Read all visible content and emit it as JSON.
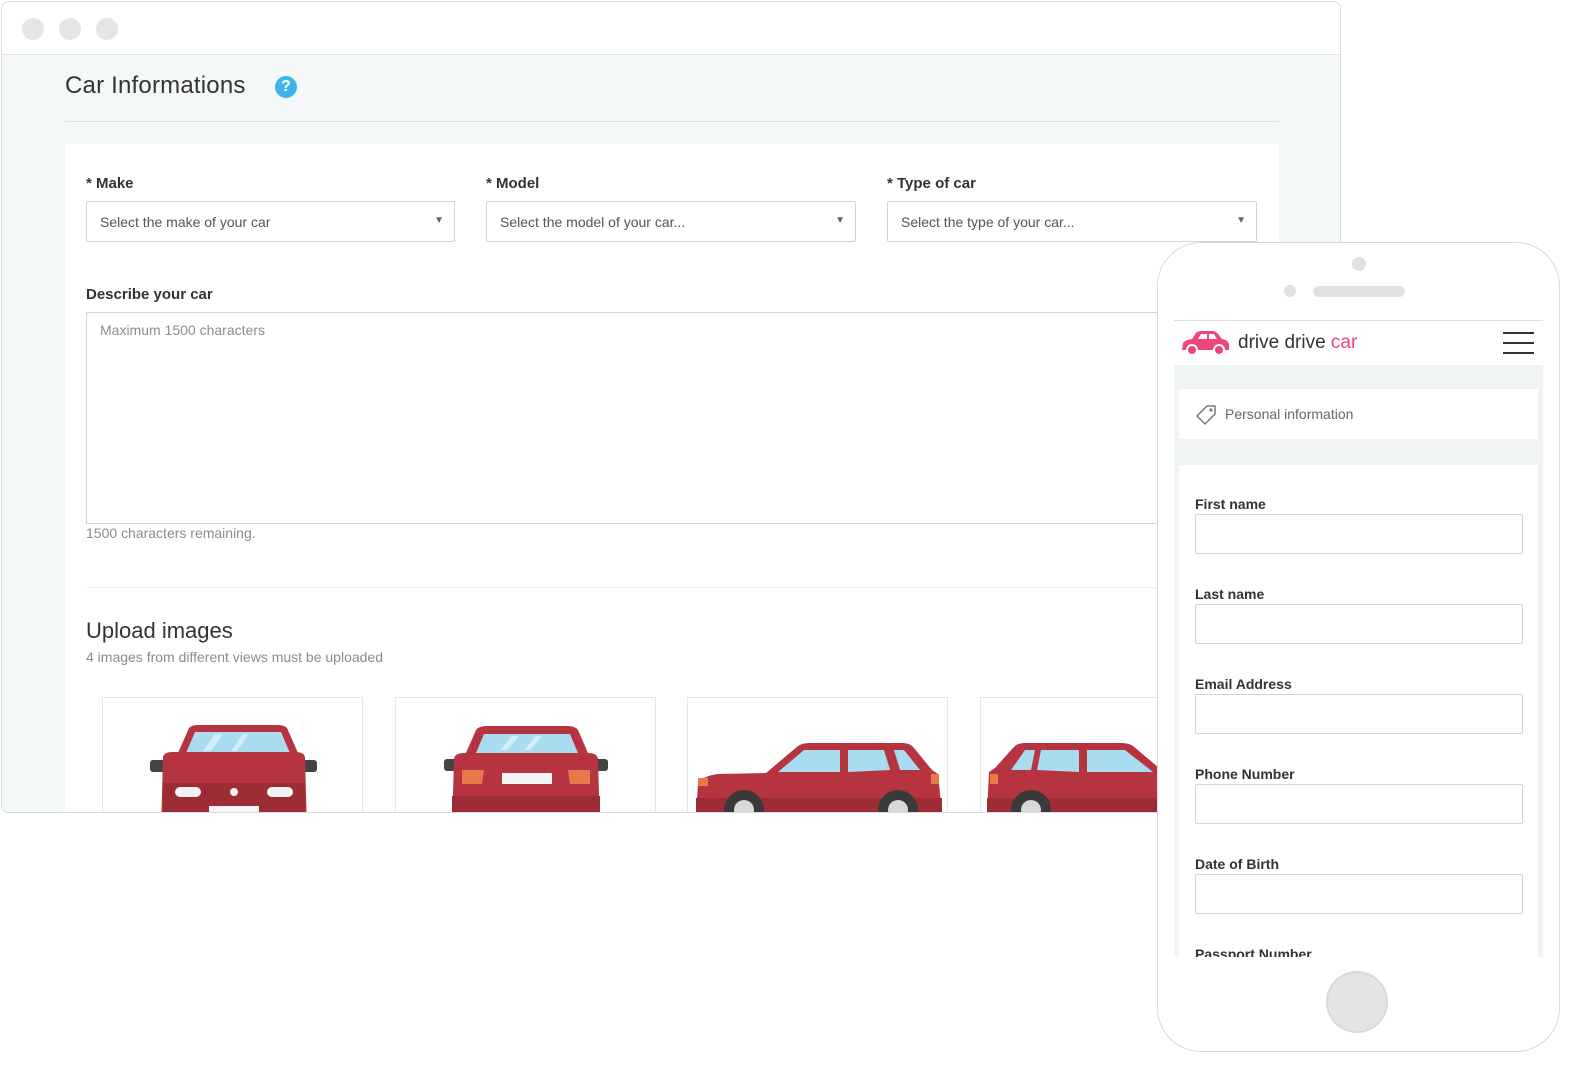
{
  "desktop": {
    "page_title": "Car Informations",
    "help_icon": "help-circle-icon",
    "make": {
      "label": "* Make",
      "placeholder": "Select the make of your car"
    },
    "model": {
      "label": "* Model",
      "placeholder": "Select the model of your car..."
    },
    "type": {
      "label": "* Type of car",
      "placeholder": "Select the type of your car..."
    },
    "description": {
      "label": "Describe your car",
      "placeholder": "Maximum 1500 characters",
      "remaining": "1500 characters remaining."
    },
    "upload": {
      "title": "Upload images",
      "subtitle": "4 images from different views must be uploaded",
      "tiles": [
        "car-front-image",
        "car-rear-image",
        "car-left-side-image",
        "car-right-side-image"
      ]
    },
    "car_color": "#b5343f"
  },
  "mobile": {
    "brand_part1": "drive drive ",
    "brand_part2": "car",
    "brand_accent_color": "#f0457a",
    "menu_icon": "hamburger-menu-icon",
    "section_tab": {
      "icon": "tag-icon",
      "label": "Personal information"
    },
    "fields": [
      {
        "label": "First name"
      },
      {
        "label": "Last name"
      },
      {
        "label": "Email Address"
      },
      {
        "label": "Phone Number"
      },
      {
        "label": "Date of Birth"
      },
      {
        "label": "Passport Number"
      }
    ]
  }
}
